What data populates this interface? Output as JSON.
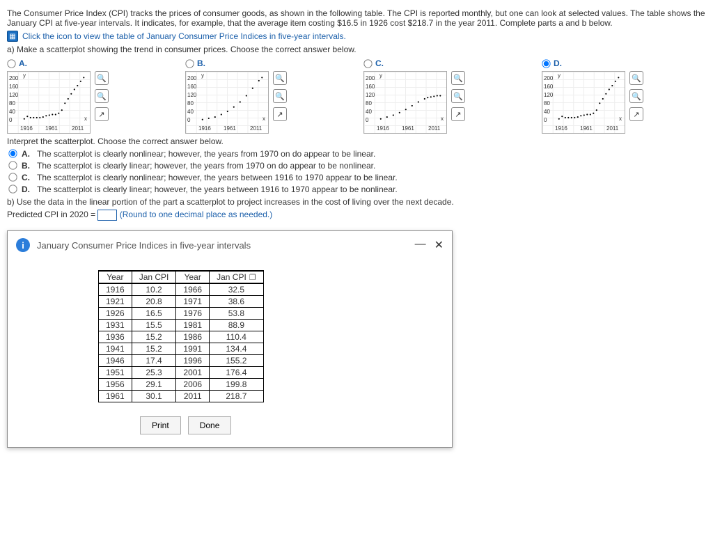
{
  "intro": "The Consumer Price Index (CPI) tracks the prices of consumer goods, as shown in the following table. The CPI is reported monthly, but one can look at selected values. The table shows the January CPI at five-year intervals. It indicates, for example, that the average item costing $16.5 in 1926 cost $218.7 in the year 2011. Complete parts a and b below.",
  "click_icon_text": "Click the icon to view the table of January Consumer Price Indices in five-year intervals.",
  "part_a_prompt": "a) Make a scatterplot showing the trend in consumer prices. Choose the correct answer below.",
  "options": [
    "A.",
    "B.",
    "C.",
    "D."
  ],
  "mini_axis": {
    "y_ticks": [
      "200",
      "160",
      "120",
      "80",
      "40",
      "0"
    ],
    "x_ticks": [
      "1916",
      "1961",
      "2011"
    ],
    "y_sym": "y",
    "x_sym": "x"
  },
  "interpret_prompt": "Interpret the scatterplot. Choose the correct answer below.",
  "interpret_choices": [
    "The scatterplot is clearly nonlinear; however, the years from 1970 on do appear to be linear.",
    "The scatterplot is clearly linear; however, the years from 1970 on do appear to be nonlinear.",
    "The scatterplot is clearly nonlinear; however, the years between 1916 to 1970 appear to be linear.",
    "The scatterplot is clearly linear; however, the years between 1916 to 1970 appear to be nonlinear."
  ],
  "interpret_letters": [
    "A.",
    "B.",
    "C.",
    "D."
  ],
  "part_b_prompt": "b) Use the data in the linear portion of the part a scatterplot to project increases in the cost of living over the next decade.",
  "predicted_label_pre": "Predicted CPI in 2020 =",
  "predicted_hint": "(Round to one decimal place as needed.)",
  "dialog": {
    "title": "January Consumer Price Indices in five-year intervals",
    "headers": [
      "Year",
      "Jan CPI",
      "Year",
      "Jan CPI"
    ],
    "rows": [
      [
        "1916",
        "10.2",
        "1966",
        "32.5"
      ],
      [
        "1921",
        "20.8",
        "1971",
        "38.6"
      ],
      [
        "1926",
        "16.5",
        "1976",
        "53.8"
      ],
      [
        "1931",
        "15.5",
        "1981",
        "88.9"
      ],
      [
        "1936",
        "15.2",
        "1986",
        "110.4"
      ],
      [
        "1941",
        "15.2",
        "1991",
        "134.4"
      ],
      [
        "1946",
        "17.4",
        "1996",
        "155.2"
      ],
      [
        "1951",
        "25.3",
        "2001",
        "176.4"
      ],
      [
        "1956",
        "29.1",
        "2006",
        "199.8"
      ],
      [
        "1961",
        "30.1",
        "2011",
        "218.7"
      ]
    ],
    "buttons": {
      "print": "Print",
      "done": "Done"
    }
  },
  "chart_data": {
    "type": "scatter",
    "xlabel": "Year",
    "ylabel": "January CPI",
    "x": [
      1916,
      1921,
      1926,
      1931,
      1936,
      1941,
      1946,
      1951,
      1956,
      1961,
      1966,
      1971,
      1976,
      1981,
      1986,
      1991,
      1996,
      2001,
      2006,
      2011
    ],
    "y": [
      10.2,
      20.8,
      16.5,
      15.5,
      15.2,
      15.2,
      17.4,
      25.3,
      29.1,
      30.1,
      32.5,
      38.6,
      53.8,
      88.9,
      110.4,
      134.4,
      155.2,
      176.4,
      199.8,
      218.7
    ],
    "xlim": [
      1916,
      2011
    ],
    "ylim": [
      0,
      220
    ]
  }
}
